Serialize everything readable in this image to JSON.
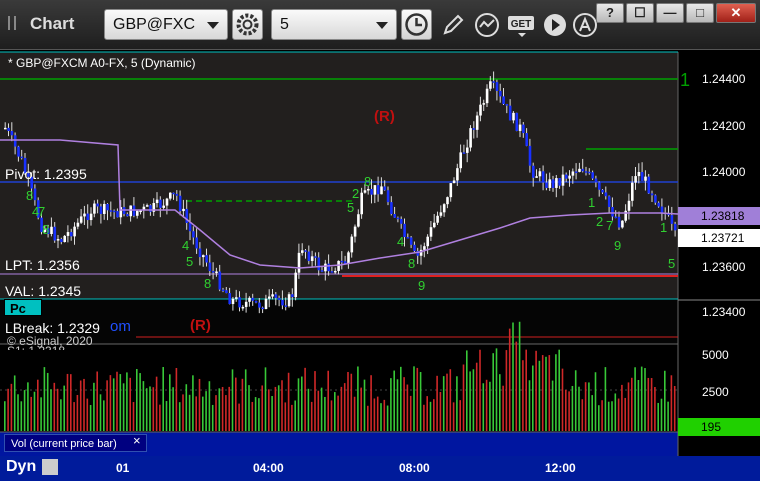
{
  "toolbar": {
    "title": "Chart",
    "symbol": "GBP@FXC",
    "interval": "5",
    "window_buttons": [
      "?",
      "☐",
      "—",
      "□",
      "✕"
    ]
  },
  "chart": {
    "symbol_label": "* GBP@FXCM A0-FX, 5 (Dynamic)",
    "price_axis_ticks": [
      "1.24400",
      "1.24200",
      "1.24000",
      "1.23600",
      "1.23400"
    ],
    "tags": [
      {
        "value": "1.23818",
        "color": "#a07fd8"
      },
      {
        "value": "1.23721",
        "color": "#ffffff"
      }
    ],
    "levels": [
      {
        "text": "Pivot: 1.2395"
      },
      {
        "text": "LPT: 1.2356"
      },
      {
        "text": "VAL: 1.2345"
      },
      {
        "text": "LBreak: 1.2329"
      }
    ],
    "pc_label": "Pc",
    "blue_text": "om",
    "copyright": "© eSignal, 2020",
    "s1_text": "S1: 1.2318",
    "r_markers": [
      "(R)",
      "(R)"
    ],
    "vol_axis_ticks": [
      "5000",
      "2500"
    ],
    "vol_tag": "195",
    "vol_label": "Vol (current price bar)",
    "vol_close": "×",
    "dyn_label": "Dyn",
    "time_labels": [
      "01",
      "04:00",
      "08:00",
      "12:00"
    ]
  }
}
